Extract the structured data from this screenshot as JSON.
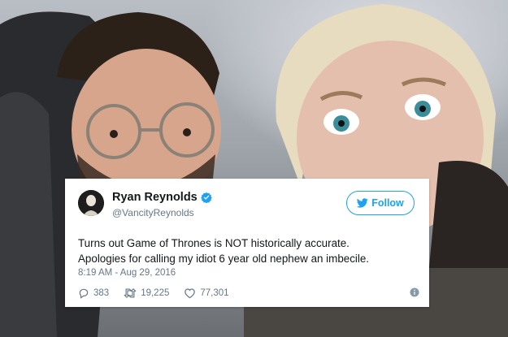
{
  "tweet": {
    "display_name": "Ryan Reynolds",
    "handle": "@VancityReynolds",
    "verified": true,
    "follow_label": "Follow",
    "text_line1": "Turns out Game of Thrones is NOT historically accurate.",
    "text_line2": "Apologies for calling my idiot 6 year old nephew an imbecile.",
    "timestamp": "8:19 AM - Aug 29, 2016",
    "replies": "383",
    "retweets": "19,225",
    "likes": "77,301"
  },
  "colors": {
    "accent": "#1da1f2",
    "text": "#14171a",
    "muted": "#657786"
  },
  "icons": [
    "verified-badge-icon",
    "twitter-bird-icon",
    "reply-icon",
    "retweet-icon",
    "like-icon",
    "info-icon"
  ]
}
